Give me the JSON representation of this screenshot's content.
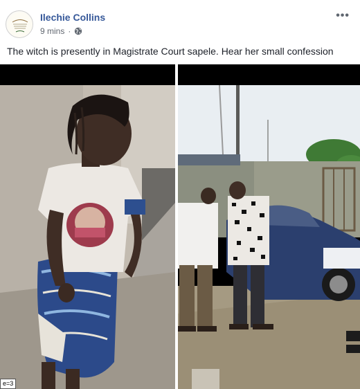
{
  "post": {
    "author": "Ilechie Collins",
    "timestamp": "9 mins",
    "privacy_icon": "globe-icon",
    "more_icon": "ellipsis-icon",
    "caption": "The witch is presently in Magistrate Court sapele. Hear her small confession",
    "badge": "e=3"
  },
  "colors": {
    "author_link": "#365899",
    "meta_text": "#616770"
  }
}
